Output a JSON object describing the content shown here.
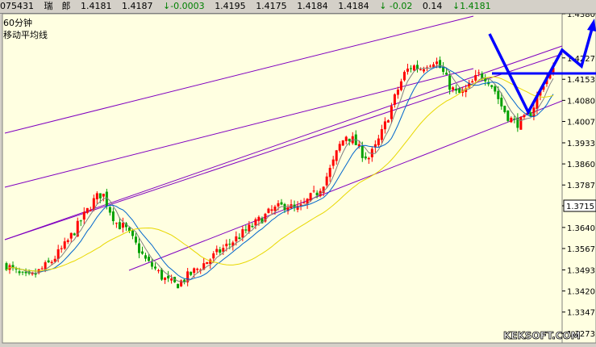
{
  "quote_bar": {
    "code": "075431",
    "name": "瑞　郎",
    "open": "1.4181",
    "high": "1.4187",
    "change": "↓-0.0003",
    "p1": "1.4195",
    "p2": "1.4175",
    "p3": "1.4184",
    "p4": "1.4184",
    "chg2": "↓ -0.02",
    "vol": "0.14",
    "last": "↓1.4181"
  },
  "chart_title": "60分钟",
  "indicator_title": "移动平均线",
  "watermark": "KEKSOFT.COM",
  "colors": {
    "plot_bg": "#ffffe1",
    "up": "#ff0000",
    "down": "#00a000",
    "channel": "#8000c0",
    "ma_fast": "#808080",
    "ma_mid": "#0066cc",
    "ma_slow": "#e8d800",
    "annotation": "#0000ff"
  },
  "chart_data": {
    "type": "candlestick",
    "ylim": [
      1.324,
      1.438
    ],
    "yticks": [
      "1.4380",
      "1.4227",
      "1.4153",
      "1.4080",
      "1.4007",
      "1.3933",
      "1.3860",
      "1.3787",
      "1.3715",
      "1.3640",
      "1.3567",
      "1.3493",
      "1.3420",
      "1.3347",
      "1.3273"
    ],
    "last_price": "1.3715",
    "close_path": [
      1.351,
      1.349,
      1.347,
      1.3465,
      1.348,
      1.35,
      1.352,
      1.355,
      1.358,
      1.362,
      1.366,
      1.37,
      1.374,
      1.376,
      1.37,
      1.365,
      1.364,
      1.36,
      1.356,
      1.352,
      1.35,
      1.347,
      1.345,
      1.344,
      1.346,
      1.348,
      1.35,
      1.352,
      1.354,
      1.356,
      1.358,
      1.36,
      1.362,
      1.364,
      1.366,
      1.368,
      1.37,
      1.371,
      1.372,
      1.37,
      1.371,
      1.374,
      1.376,
      1.38,
      1.385,
      1.392,
      1.396,
      1.394,
      1.39,
      1.388,
      1.392,
      1.398,
      1.405,
      1.412,
      1.418,
      1.42,
      1.419,
      1.421,
      1.422,
      1.418,
      1.413,
      1.41,
      1.411,
      1.414,
      1.417,
      1.416,
      1.412,
      1.406,
      1.402,
      1.4,
      1.401,
      1.404,
      1.41,
      1.416,
      1.4181
    ]
  }
}
